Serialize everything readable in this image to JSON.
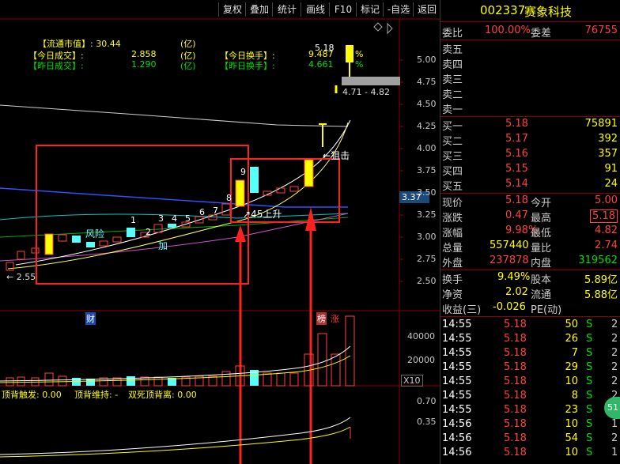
{
  "toolbar": {
    "buttons": [
      "复权",
      "叠加",
      "统计",
      "画线",
      "F10",
      "标记",
      "-自选",
      "返回"
    ]
  },
  "info_panel": {
    "line1_label": "【流通市值】: 30.44",
    "line1_unit": "(亿)",
    "line2_label": "【今日成交】:",
    "line2_value": "2.858",
    "line2_unit": "(亿)",
    "line3_label": "【昨日成交】:",
    "line3_value": "1.290",
    "line3_unit": "(亿)",
    "line2r_label": "【今日换手】:",
    "line2r_value": "9.487",
    "line2r_unit": "%",
    "line3r_label": "【昨日换手】:",
    "line3r_value": "4.661",
    "line3r_unit": "%"
  },
  "price_axis": [
    "5.00",
    "4.75",
    "4.50",
    "4.25",
    "4.00",
    "3.75",
    "3.50",
    "3.25",
    "3.00",
    "2.75",
    "2.50"
  ],
  "current_price_tag": "3.37",
  "volume_axis": [
    "40000",
    "20000"
  ],
  "volume_unit": "X10",
  "indicator_axis": [
    "0.70",
    "0.35"
  ],
  "annotations": {
    "top_value": "5.18",
    "range_text": "4.71 - 4.82",
    "low_label": "2.55",
    "risk": "风险",
    "add": "加",
    "rise45": "45上升",
    "snipe": "狙击",
    "cai": "财",
    "bang": "榜",
    "zhang": "涨",
    "counters": [
      "1",
      "2",
      "3",
      "4",
      "5",
      "6",
      "7",
      "8",
      "9"
    ]
  },
  "indicator_legend": {
    "trigger": "顶背触发: 0.00",
    "maintain": "顶背维持: -",
    "double": "双死顶背离: 0.00"
  },
  "stock": {
    "code": "002337",
    "name": "赛象科技"
  },
  "ratio": {
    "label1": "委比",
    "value1": "100.00%",
    "label2": "委差",
    "value2": "76755"
  },
  "asks": [
    {
      "label": "卖五"
    },
    {
      "label": "卖四"
    },
    {
      "label": "卖三"
    },
    {
      "label": "卖二"
    },
    {
      "label": "卖一"
    }
  ],
  "bids": [
    {
      "label": "买一",
      "price": "5.18",
      "vol": "75891"
    },
    {
      "label": "买二",
      "price": "5.17",
      "vol": "392"
    },
    {
      "label": "买三",
      "price": "5.16",
      "vol": "357"
    },
    {
      "label": "买四",
      "price": "5.15",
      "vol": "91"
    },
    {
      "label": "买五",
      "price": "5.14",
      "vol": "24"
    }
  ],
  "quote": [
    {
      "l1": "现价",
      "v1": "5.18",
      "l2": "今开",
      "v2": "5.00"
    },
    {
      "l1": "涨跌",
      "v1": "0.47",
      "l2": "最高",
      "v2": "5.18"
    },
    {
      "l1": "涨幅",
      "v1": "9.98%",
      "l2": "最低",
      "v2": "4.82"
    },
    {
      "l1": "总量",
      "v1": "557440",
      "l2": "量比",
      "v2": "2.74"
    },
    {
      "l1": "外盘",
      "v1": "237878",
      "l2": "内盘",
      "v2": "319562"
    }
  ],
  "stats": [
    {
      "l1": "换手",
      "v1": "9.49%",
      "l2": "股本",
      "v2": "5.89亿"
    },
    {
      "l1": "净资",
      "v1": "2.02",
      "l2": "流通",
      "v2": "5.88亿"
    },
    {
      "l1": "收益(三)",
      "v1": "-0.026",
      "l2": "PE(动)",
      "v2": ""
    }
  ],
  "ticks": [
    {
      "time": "14:55",
      "price": "5.18",
      "vol": "50",
      "side": "S",
      "n": "2"
    },
    {
      "time": "14:55",
      "price": "5.18",
      "vol": "26",
      "side": "S",
      "n": "2"
    },
    {
      "time": "14:55",
      "price": "5.18",
      "vol": "7",
      "side": "S",
      "n": "2"
    },
    {
      "time": "14:55",
      "price": "5.18",
      "vol": "29",
      "side": "S",
      "n": "2"
    },
    {
      "time": "14:55",
      "price": "5.18",
      "vol": "10",
      "side": "S",
      "n": "2"
    },
    {
      "time": "14:55",
      "price": "5.18",
      "vol": "8",
      "side": "S",
      "n": "2"
    },
    {
      "time": "14:55",
      "price": "5.18",
      "vol": "23",
      "side": "S",
      "n": "2"
    },
    {
      "time": "14:56",
      "price": "5.18",
      "vol": "10",
      "side": "S",
      "n": "1"
    },
    {
      "time": "14:56",
      "price": "5.18",
      "vol": "54",
      "side": "S",
      "n": "2"
    },
    {
      "time": "14:56",
      "price": "5.18",
      "vol": "10",
      "side": "S",
      "n": "1"
    }
  ],
  "float_badge": "51",
  "colors": {
    "red": "#ff3b3b",
    "green": "#00e000",
    "cyan": "#57ffff",
    "yellow": "#ffff00",
    "blue_header": "#00b4ff",
    "gold": "#ffff00"
  }
}
